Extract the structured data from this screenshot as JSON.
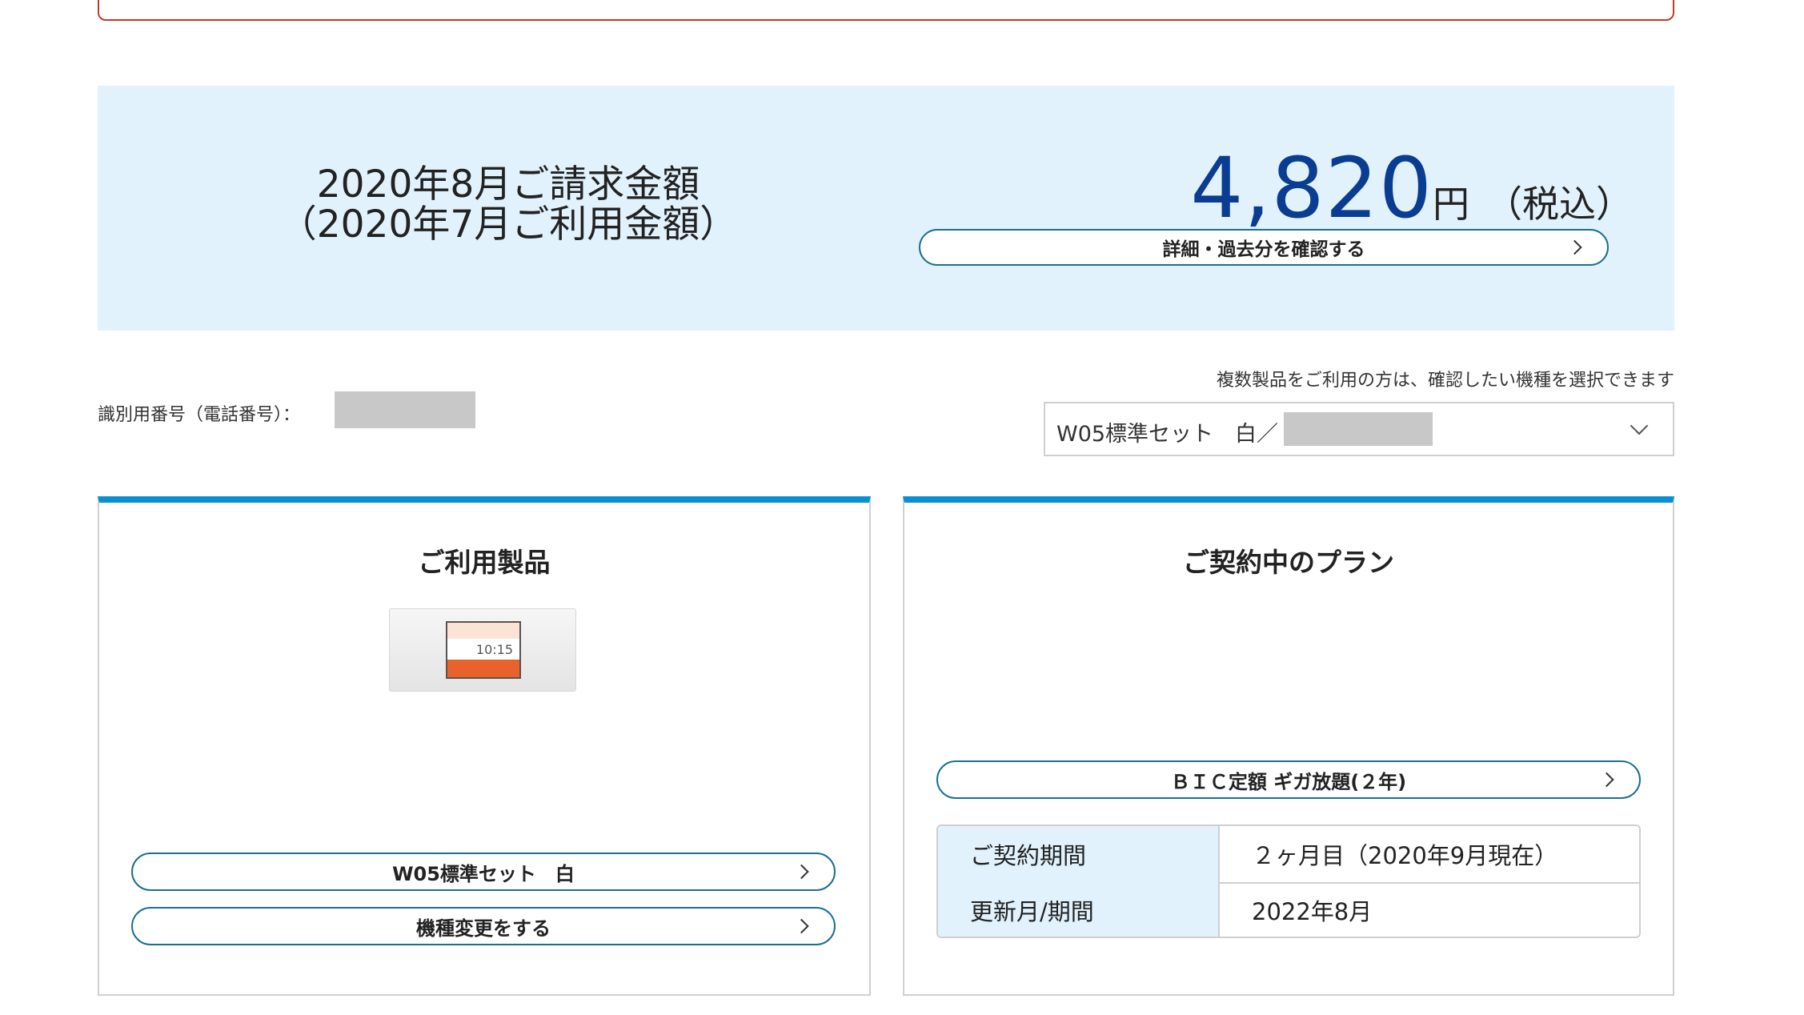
{
  "billing": {
    "title_line1": "2020年8月ご請求金額",
    "title_line2": "（2020年7月ご利用金額）",
    "amount": "4,820",
    "unit": "円",
    "tax_note": "（税込）",
    "detail_button": "詳細・過去分を確認する"
  },
  "identity": {
    "id_label": "識別用番号（電話番号）："
  },
  "device_selector": {
    "hint": "複数製品をご利用の方は、確認したい機種を選択できます",
    "selected_value": "W05標準セット　白／"
  },
  "product_card": {
    "title": "ご利用製品",
    "device_time": "10:15",
    "device_button": "W05標準セット　白",
    "change_button": "機種変更をする"
  },
  "plan_card": {
    "title": "ご契約中のプラン",
    "plan_button": "ＢＩＣ定額 ギガ放題(２年)",
    "rows": [
      {
        "label": "ご契約期間",
        "value": "２ヶ月目（2020年9月現在）"
      },
      {
        "label": "更新月/期間",
        "value": "2022年8月"
      }
    ]
  },
  "colors": {
    "accent_blue": "#0a8fcf",
    "amount_blue": "#0a3d91",
    "banner_bg": "#e1f2fc",
    "alert_red": "#c0392b"
  }
}
